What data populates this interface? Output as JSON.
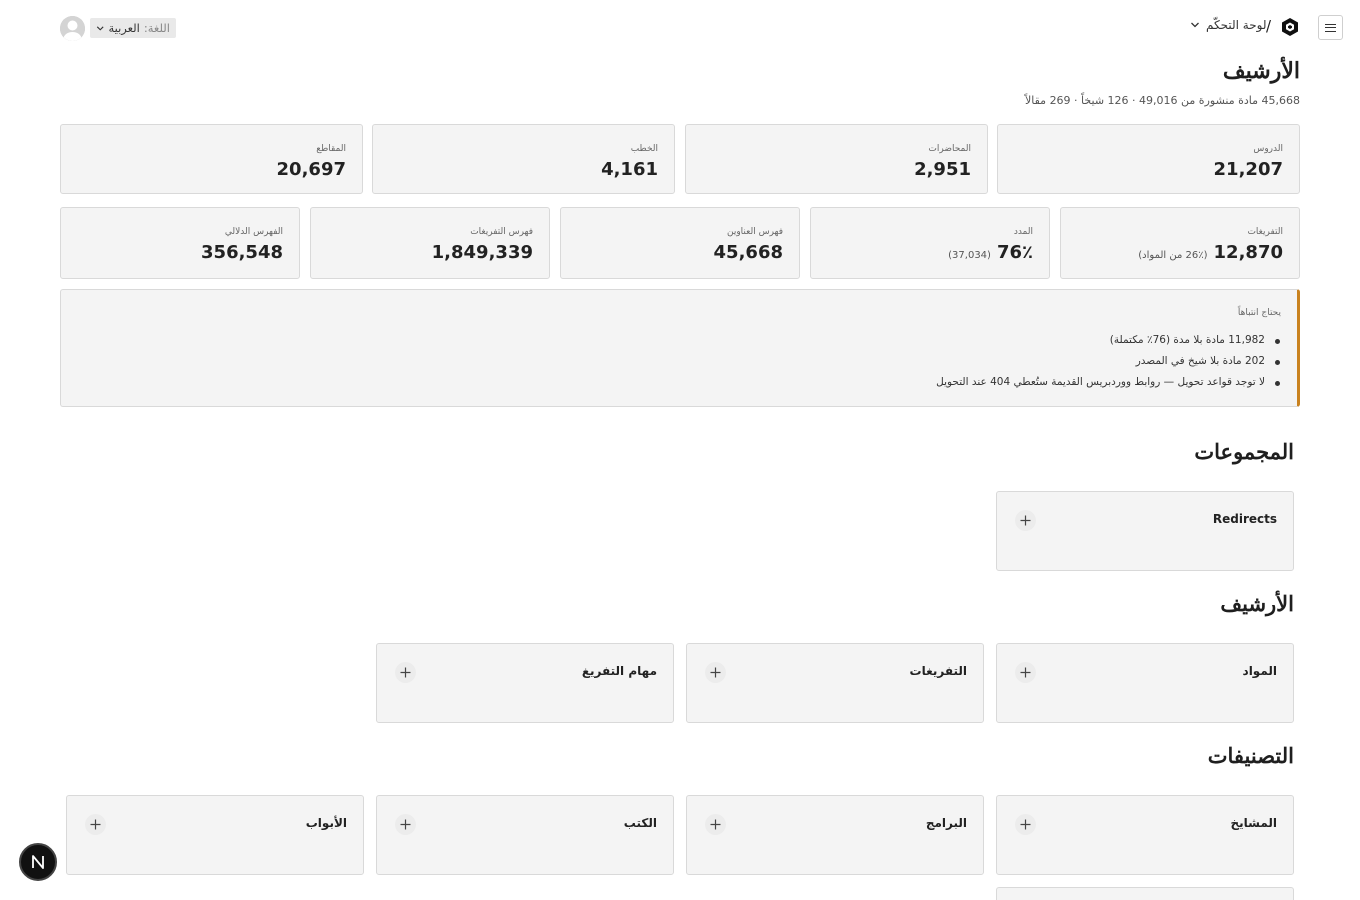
{
  "header": {
    "breadcrumb_label": "لوحة التحكّم",
    "breadcrumb_separator": "/",
    "language_label": "اللغة:",
    "language_value": "العربية"
  },
  "page": {
    "title": "الأرشيف",
    "subtitle": "45,668 مادة منشورة من 49,016 · 126 شيخاً · 269 مقالاً"
  },
  "stats_row1": [
    {
      "label": "الدروس",
      "value": "21,207"
    },
    {
      "label": "المحاضرات",
      "value": "2,951"
    },
    {
      "label": "الخطب",
      "value": "4,161"
    },
    {
      "label": "المقاطع",
      "value": "20,697"
    }
  ],
  "stats_row2": [
    {
      "label": "التفريغات",
      "value": "12,870",
      "extra": "(26٪ من المواد)"
    },
    {
      "label": "المدد",
      "value": "76٪",
      "extra": "(37,034)"
    },
    {
      "label": "فهرس العناوين",
      "value": "45,668"
    },
    {
      "label": "فهرس التفريغات",
      "value": "1,849,339"
    },
    {
      "label": "الفهرس الدلالي",
      "value": "356,548"
    }
  ],
  "attention": {
    "title": "يحتاج انتباهاً",
    "items": [
      "11,982 مادة بلا مدة (76٪ مكتملة)",
      "202 مادة بلا شيخ في المصدر",
      "لا توجد قواعد تحويل — روابط ووردبريس القديمة ستُعطي 404 عند التحويل"
    ]
  },
  "sections": {
    "groups": {
      "title": "المجموعات",
      "tiles": [
        "Redirects"
      ]
    },
    "archive": {
      "title": "الأرشيف",
      "tiles": [
        "المواد",
        "التفريغات",
        "مهام التفريغ"
      ]
    },
    "categories": {
      "title": "التصنيفات",
      "tiles": [
        "المشايخ",
        "البرامج",
        "الكتب",
        "الأبواب"
      ]
    }
  },
  "badge": {
    "letter": "N"
  },
  "icons": [
    "menu-icon",
    "logo-icon",
    "chevron-down-icon",
    "avatar-icon",
    "plus-icon"
  ],
  "colors": {
    "accent": "#c9821f",
    "card_bg": "#f4f4f4",
    "border": "#d9d9d9"
  }
}
